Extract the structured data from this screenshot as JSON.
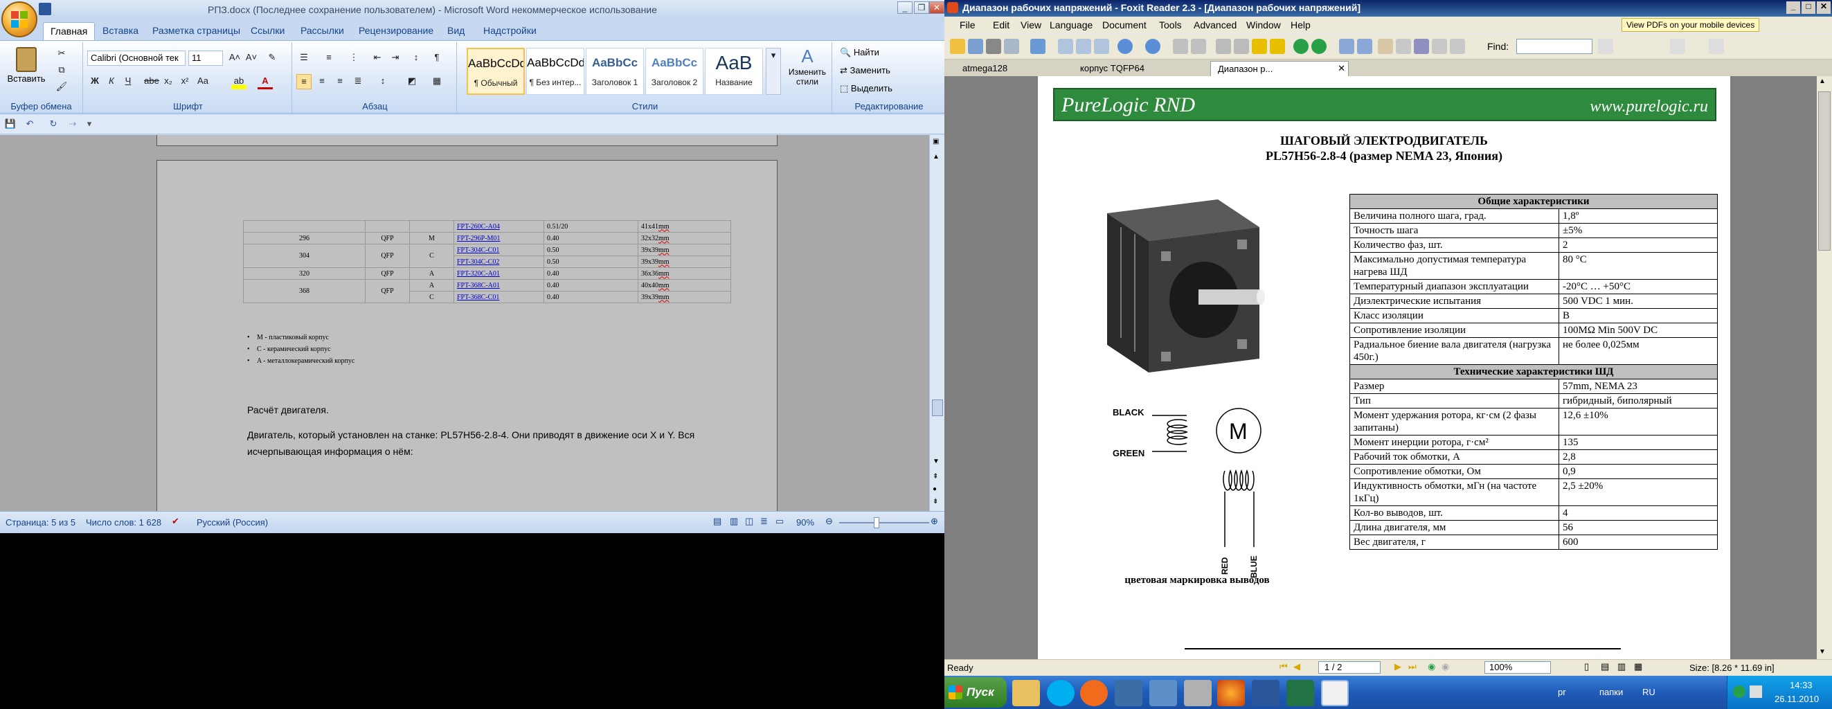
{
  "word": {
    "title": "РПЗ.docx (Последнее сохранение пользователем) - Microsoft Word некоммерческое использование",
    "tabs": [
      "Главная",
      "Вставка",
      "Разметка страницы",
      "Ссылки",
      "Рассылки",
      "Рецензирование",
      "Вид",
      "Надстройки"
    ],
    "ribbon": {
      "clipboard": {
        "paste_label": "Вставить",
        "group_label": "Буфер обмена"
      },
      "font": {
        "font_name": "Calibri (Основной тек",
        "font_size": "11",
        "group_label": "Шрифт",
        "bold": "Ж",
        "italic": "К",
        "underline": "Ч",
        "strike": "abe",
        "sub": "x₂",
        "sup": "x²",
        "case": "Aa"
      },
      "paragraph": {
        "group_label": "Абзац"
      },
      "styles": {
        "group_label": "Стили",
        "items": [
          {
            "sample": "AaBbCcDd",
            "name": "¶ Обычный"
          },
          {
            "sample": "AaBbCcDd",
            "name": "¶ Без интер..."
          },
          {
            "sample": "AaBbCc",
            "name": "Заголовок 1"
          },
          {
            "sample": "AaBbCc",
            "name": "Заголовок 2"
          },
          {
            "sample": "AaB",
            "name": "Название"
          }
        ],
        "change_styles": "Изменить стили"
      },
      "editing": {
        "group_label": "Редактирование",
        "find": "Найти",
        "replace": "Заменить",
        "select": "Выделить"
      }
    },
    "doc": {
      "table_rows": [
        {
          "pins": "",
          "pkg": "",
          "type": "",
          "part": "FPT-260C-A04",
          "pitch": "0.51/20",
          "size": "41x41",
          "unit": "mm"
        },
        {
          "pins": "296",
          "pkg": "QFP",
          "type": "M",
          "part": "FPT-296P-M01",
          "pitch": "0.40",
          "size": "32x32",
          "unit": "mm"
        },
        {
          "pins": "304",
          "pkg": "QFP",
          "type": "C",
          "part": "FPT-304C-C01",
          "pitch": "0.50",
          "size": "39x39",
          "unit": "mm"
        },
        {
          "pins": "",
          "pkg": "",
          "type": "",
          "part": "FPT-304C-C02",
          "pitch": "0.50",
          "size": "39x39",
          "unit": "mm"
        },
        {
          "pins": "320",
          "pkg": "QFP",
          "type": "A",
          "part": "FPT-320C-A01",
          "pitch": "0.40",
          "size": "36x36",
          "unit": "mm"
        },
        {
          "pins": "368",
          "pkg": "QFP",
          "type": "A",
          "part": "FPT-368C-A01",
          "pitch": "0.40",
          "size": "40x40",
          "unit": "mm"
        },
        {
          "pins": "",
          "pkg": "",
          "type": "C",
          "part": "FPT-368C-C01",
          "pitch": "0.40",
          "size": "39x39",
          "unit": "mm"
        }
      ],
      "legend": [
        "M - пластиковый корпус",
        "C - керамический корпус",
        "A - металлокерамический корпус"
      ],
      "heading": "Расчёт двигателя.",
      "para1": "Двигатель, который установлен на станке: PL57H56-2.8-4. Они приводят в движение оси X и Y. Вся",
      "para2": "исчерпывающая информация о нём:"
    },
    "status": {
      "page": "Страница: 5 из 5",
      "words": "Число слов: 1 628",
      "lang": "Русский (Россия)",
      "zoom": "90%"
    }
  },
  "foxit": {
    "title": "Диапазон рабочих напряжений - Foxit Reader 2.3 - [Диапазон рабочих напряжений]",
    "menu": [
      "File",
      "Edit",
      "View",
      "Language",
      "Document",
      "Tools",
      "Advanced",
      "Window",
      "Help"
    ],
    "promo": "View PDFs on your mobile devices",
    "find_label": "Find:",
    "tabs": [
      "atmega128",
      "корпус TQFP64",
      "Диапазон р..."
    ],
    "pdf": {
      "brand": "PureLogic RND",
      "site": "www.purelogic.ru",
      "title1": "ШАГОВЫЙ ЭЛЕКТРОДВИГАТЕЛЬ",
      "title2": "PL57H56-2.8-4 (размер NEMA 23, Япония)",
      "section1": "Общие характеристики",
      "rows1": [
        [
          "Величина полного шага, град.",
          "1,8º"
        ],
        [
          "Точность шага",
          "±5%"
        ],
        [
          "Количество фаз, шт.",
          "2"
        ],
        [
          "Максимально допустимая температура нагрева ШД",
          "80 °C"
        ],
        [
          "Температурный диапазон эксплуатации",
          "-20°C … +50°C"
        ],
        [
          "Диэлектрические испытания",
          "500 VDC 1 мин."
        ],
        [
          "Класс изоляции",
          "B"
        ],
        [
          "Сопротивление изоляции",
          "100MΩ Min 500V DC"
        ],
        [
          "Радиальное биение вала двигателя (нагрузка 450г.)",
          "не более 0,025мм"
        ]
      ],
      "section2": "Технические характеристики ШД",
      "rows2": [
        [
          "Размер",
          "57mm, NEMA 23"
        ],
        [
          "Тип",
          "гибридный, биполярный"
        ],
        [
          "Момент удержания ротора, кг·см (2 фазы запитаны)",
          "12,6 ±10%"
        ],
        [
          "Момент инерции ротора, г·см²",
          "135"
        ],
        [
          "Рабочий ток обмотки, А",
          "2,8"
        ],
        [
          "Сопротивление обмотки, Ом",
          "0,9"
        ],
        [
          "Индуктивность обмотки, мГн (на частоте 1кГц)",
          "2,5 ±20%"
        ],
        [
          "Кол-во выводов, шт.",
          "4"
        ],
        [
          "Длина двигателя, мм",
          "56"
        ],
        [
          "Вес двигателя, г",
          "600"
        ]
      ],
      "wire_labels": {
        "black": "BLACK",
        "green": "GREEN",
        "red": "RED",
        "blue": "BLUE",
        "m": "M"
      },
      "wire_caption": "цветовая маркировка выводов"
    },
    "status": {
      "ready": "Ready",
      "page": "1 / 2",
      "zoom": "100%",
      "size": "Size: [8.26 * 11.69 in]"
    }
  },
  "taskbar": {
    "start": "Пуск",
    "lang_pr": "pr",
    "folders": "папки",
    "lang": "RU",
    "time": "14:33",
    "date": "26.11.2010"
  }
}
